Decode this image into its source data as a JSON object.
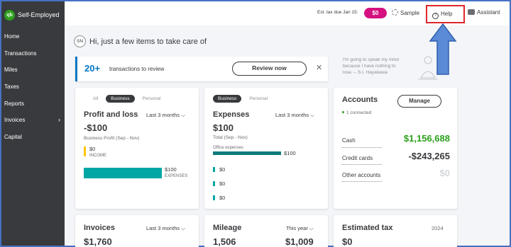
{
  "sidebar": {
    "brand": "Self-Employed",
    "items": [
      {
        "label": "Home"
      },
      {
        "label": "Transactions"
      },
      {
        "label": "Miles"
      },
      {
        "label": "Taxes"
      },
      {
        "label": "Reports"
      },
      {
        "label": "Invoices",
        "chevron": "›"
      },
      {
        "label": "Capital"
      }
    ]
  },
  "topbar": {
    "tax_label": "Est. tax due Jan 15:",
    "tax_value": "$0",
    "sample": "Sample",
    "help": "Help",
    "assistant": "Assistant"
  },
  "greeting": {
    "initials": "SN",
    "text": "Hi, just a few items to take care of"
  },
  "review": {
    "count": "20+",
    "text": "transactions to review",
    "button": "Review now",
    "close": "✕"
  },
  "quote": {
    "text": "I'm going to speak my mind because I have nothing to lose. – S.I. Hayakawa"
  },
  "profit": {
    "tabs": [
      "All",
      "Business",
      "Personal"
    ],
    "title": "Profit and loss",
    "period": "Last 3 months",
    "value": "-$100",
    "subtitle": "Business Profit (Sep - Nov)",
    "income_value": "$0",
    "income_label": "INCOME",
    "expenses_value": "$100",
    "expenses_label": "EXPENSES"
  },
  "expenses": {
    "tabs": [
      "Business",
      "Personal"
    ],
    "title": "Expenses",
    "period": "Last 3 months",
    "value": "$100",
    "subtitle": "Total (Sep - Nov)",
    "rows": [
      {
        "label": "Office expenses",
        "value": "$100"
      },
      {
        "value": "$0"
      },
      {
        "value": "$0"
      },
      {
        "value": "$0"
      }
    ]
  },
  "accounts": {
    "title": "Accounts",
    "manage": "Manage",
    "connected": "1 connected",
    "rows": [
      {
        "label": "Cash",
        "value": "$1,156,688",
        "color": "#2ca01c"
      },
      {
        "label": "Credit cards",
        "value": "-$243,265",
        "color": "#393a3d"
      },
      {
        "label": "Other accounts",
        "value": "$0",
        "color": "#d4d7dc"
      }
    ]
  },
  "invoices": {
    "title": "Invoices",
    "period": "Last 3 months",
    "value": "$1,760"
  },
  "mileage": {
    "title": "Mileage",
    "period": "This year",
    "value": "1,506",
    "value2": "$1,009"
  },
  "estimated_tax": {
    "title": "Estimated tax",
    "year": "2024",
    "value": "$0"
  }
}
